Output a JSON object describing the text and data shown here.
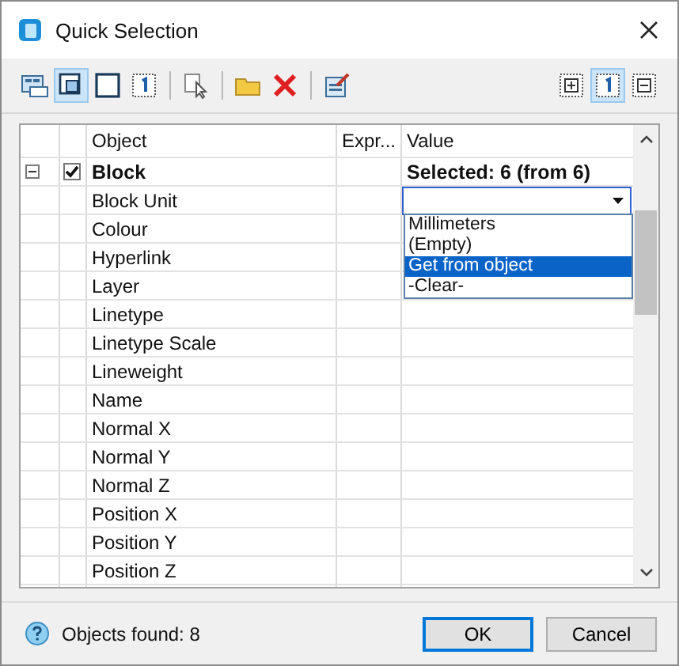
{
  "window": {
    "title": "Quick Selection"
  },
  "toolbar": {
    "left": [
      {
        "kind": "fields",
        "selected": false
      },
      {
        "kind": "window",
        "selected": true
      },
      {
        "kind": "square",
        "selected": false
      },
      {
        "kind": "one",
        "selected": false
      },
      {
        "kind": "separator"
      },
      {
        "kind": "cursor",
        "selected": false
      },
      {
        "kind": "separator"
      },
      {
        "kind": "folder",
        "selected": false
      },
      {
        "kind": "delete",
        "selected": false
      },
      {
        "kind": "separator"
      },
      {
        "kind": "edit",
        "selected": false
      }
    ],
    "right": [
      {
        "kind": "plus",
        "selected": false
      },
      {
        "kind": "one",
        "selected": true
      },
      {
        "kind": "minus",
        "selected": false
      }
    ]
  },
  "table": {
    "columns": [
      "Object",
      "Expr...",
      "Value"
    ],
    "group": {
      "name": "Block",
      "expanded": true,
      "checked": true,
      "value": "Selected: 6 (from 6)"
    },
    "rows": [
      {
        "name": "Block Unit"
      },
      {
        "name": "Colour"
      },
      {
        "name": "Hyperlink"
      },
      {
        "name": "Layer"
      },
      {
        "name": "Linetype"
      },
      {
        "name": "Linetype Scale"
      },
      {
        "name": "Lineweight"
      },
      {
        "name": "Name"
      },
      {
        "name": "Normal X"
      },
      {
        "name": "Normal Y"
      },
      {
        "name": "Normal Z"
      },
      {
        "name": "Position X"
      },
      {
        "name": "Position Y"
      },
      {
        "name": "Position Z"
      }
    ],
    "dropdown": {
      "options": [
        {
          "label": "Millimeters",
          "selected": false
        },
        {
          "label": "(Empty)",
          "selected": false
        },
        {
          "label": "Get from object",
          "selected": true
        },
        {
          "label": "-Clear-",
          "selected": false
        }
      ]
    }
  },
  "status": "Objects found: 8",
  "buttons": [
    "OK",
    "Cancel"
  ]
}
